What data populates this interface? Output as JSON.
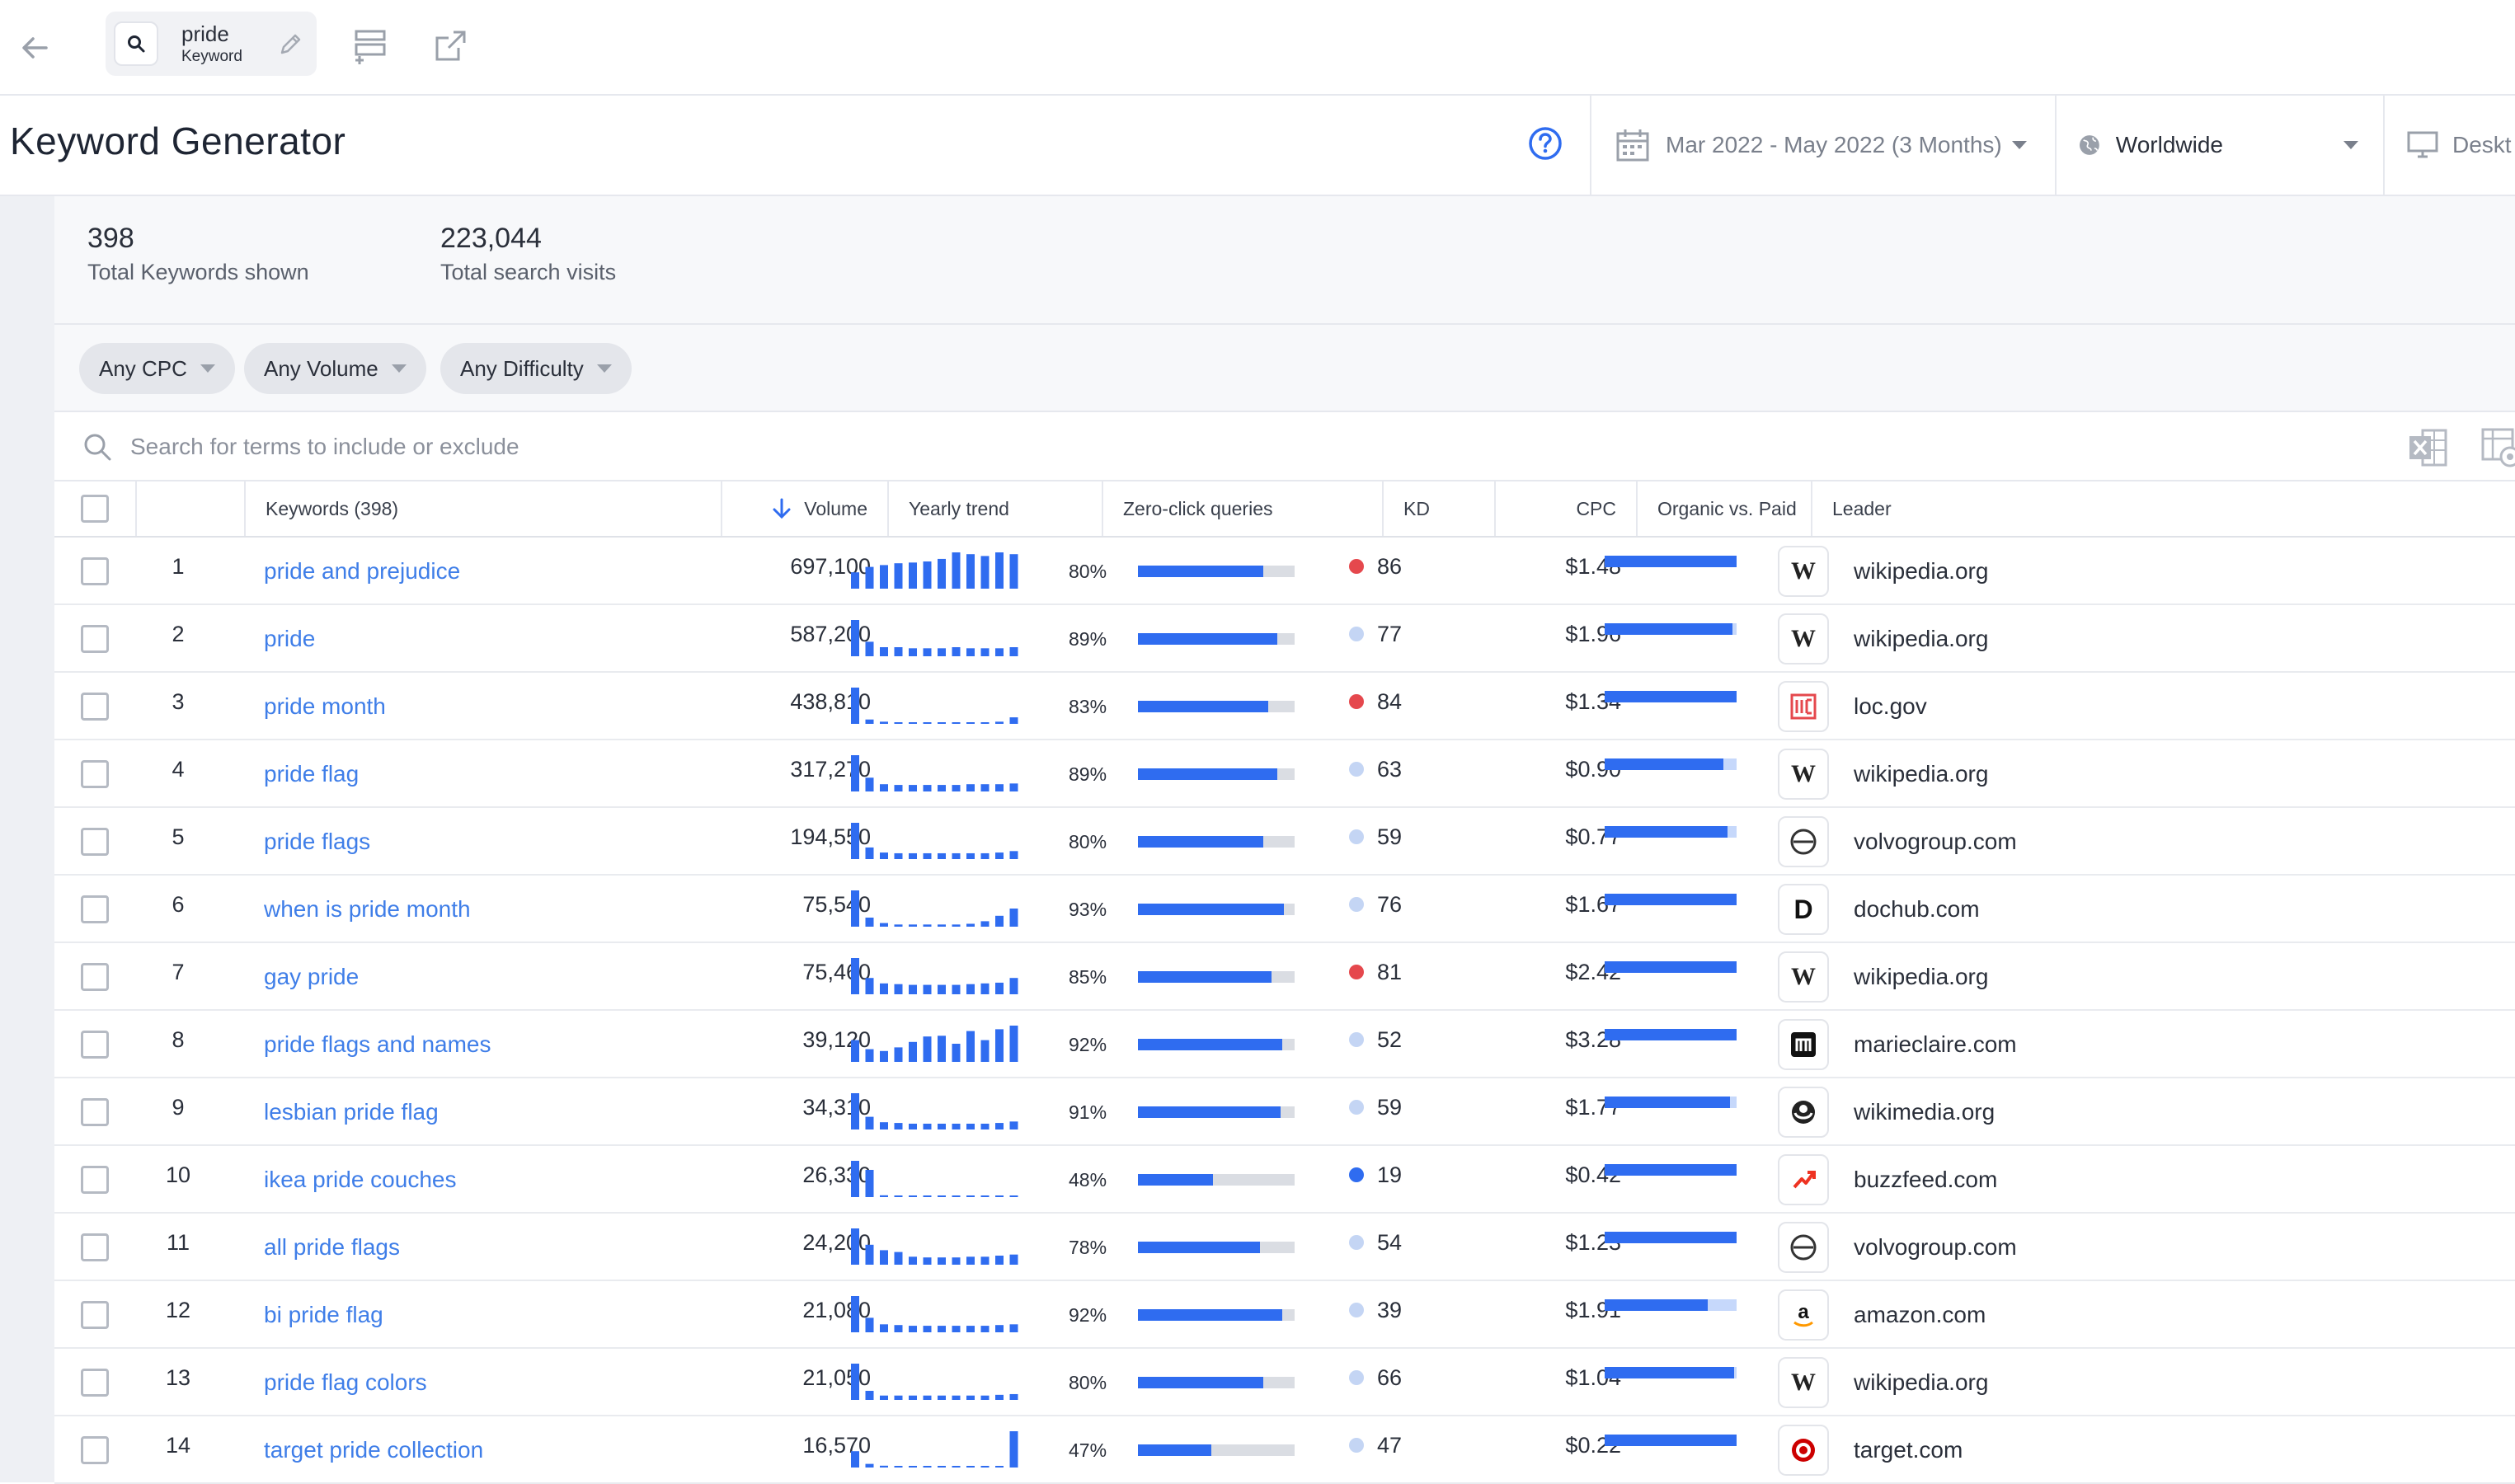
{
  "topbar": {
    "chip_title": "pride",
    "chip_subtitle": "Keyword"
  },
  "header": {
    "title": "Keyword Generator",
    "date_range": "Mar 2022 - May 2022 (3 Months)",
    "region": "Worldwide",
    "device": "Deskt"
  },
  "summary": {
    "keywords_count": "398",
    "keywords_label": "Total Keywords shown",
    "visits_count": "223,044",
    "visits_label": "Total search visits"
  },
  "filters": {
    "cpc": "Any CPC",
    "volume": "Any Volume",
    "difficulty": "Any Difficulty"
  },
  "search": {
    "placeholder": "Search for terms to include or exclude"
  },
  "columns": {
    "keywords": "Keywords (398)",
    "volume": "Volume",
    "trend": "Yearly trend",
    "zero_click": "Zero-click queries",
    "kd": "KD",
    "cpc": "CPC",
    "ovp": "Organic vs. Paid",
    "leader": "Leader"
  },
  "colors": {
    "accent": "#2f6cf0",
    "link": "#3f7ee8",
    "kd_high": "#e5484d",
    "kd_mid": "#c4d5f4",
    "kd_low": "#2f6cf0"
  },
  "rows": [
    {
      "n": "1",
      "kw": "pride and prejudice",
      "vol": "697,100",
      "trend": [
        0.45,
        0.6,
        0.65,
        0.7,
        0.72,
        0.75,
        0.82,
        1.0,
        0.95,
        0.9,
        1.0,
        0.95
      ],
      "zc": "80%",
      "zcv": 0.8,
      "kd": "86",
      "kdlvl": "high",
      "cpc": "$1.48",
      "ovp": 1.0,
      "logo": "wikipedia-logo",
      "leader": "wikipedia.org"
    },
    {
      "n": "2",
      "kw": "pride",
      "vol": "587,200",
      "trend": [
        1.0,
        0.4,
        0.25,
        0.25,
        0.22,
        0.22,
        0.22,
        0.25,
        0.22,
        0.22,
        0.22,
        0.25
      ],
      "zc": "89%",
      "zcv": 0.89,
      "kd": "77",
      "kdlvl": "mid",
      "cpc": "$1.96",
      "ovp": 0.97,
      "logo": "wikipedia-logo",
      "leader": "wikipedia.org"
    },
    {
      "n": "3",
      "kw": "pride month",
      "vol": "438,810",
      "trend": [
        1.0,
        0.12,
        0.06,
        0.04,
        0.04,
        0.04,
        0.04,
        0.04,
        0.04,
        0.04,
        0.06,
        0.18
      ],
      "zc": "83%",
      "zcv": 0.83,
      "kd": "84",
      "kdlvl": "high",
      "cpc": "$1.34",
      "ovp": 1.0,
      "logo": "loc-logo",
      "leader": "loc.gov"
    },
    {
      "n": "4",
      "kw": "pride flag",
      "vol": "317,270",
      "trend": [
        1.0,
        0.38,
        0.2,
        0.18,
        0.18,
        0.18,
        0.18,
        0.18,
        0.2,
        0.2,
        0.2,
        0.22
      ],
      "zc": "89%",
      "zcv": 0.89,
      "kd": "63",
      "kdlvl": "mid",
      "cpc": "$0.90",
      "ovp": 0.9,
      "logo": "wikipedia-logo",
      "leader": "wikipedia.org"
    },
    {
      "n": "5",
      "kw": "pride flags",
      "vol": "194,550",
      "trend": [
        1.0,
        0.32,
        0.18,
        0.16,
        0.16,
        0.16,
        0.16,
        0.16,
        0.16,
        0.16,
        0.18,
        0.22
      ],
      "zc": "80%",
      "zcv": 0.8,
      "kd": "59",
      "kdlvl": "mid",
      "cpc": "$0.77",
      "ovp": 0.93,
      "logo": "volvo-logo",
      "leader": "volvogroup.com"
    },
    {
      "n": "6",
      "kw": "when is pride month",
      "vol": "75,540",
      "trend": [
        1.0,
        0.25,
        0.1,
        0.06,
        0.06,
        0.06,
        0.06,
        0.06,
        0.08,
        0.15,
        0.3,
        0.5
      ],
      "zc": "93%",
      "zcv": 0.93,
      "kd": "76",
      "kdlvl": "mid",
      "cpc": "$1.67",
      "ovp": 1.0,
      "logo": "dochub-logo",
      "leader": "dochub.com"
    },
    {
      "n": "7",
      "kw": "gay pride",
      "vol": "75,460",
      "trend": [
        1.0,
        0.45,
        0.3,
        0.28,
        0.26,
        0.26,
        0.26,
        0.26,
        0.28,
        0.3,
        0.32,
        0.45
      ],
      "zc": "85%",
      "zcv": 0.85,
      "kd": "81",
      "kdlvl": "high",
      "cpc": "$2.42",
      "ovp": 1.0,
      "logo": "wikipedia-logo",
      "leader": "wikipedia.org"
    },
    {
      "n": "8",
      "kw": "pride flags and names",
      "vol": "39,120",
      "trend": [
        0.6,
        0.35,
        0.3,
        0.4,
        0.55,
        0.7,
        0.72,
        0.5,
        0.85,
        0.6,
        0.9,
        1.0
      ],
      "zc": "92%",
      "zcv": 0.92,
      "kd": "52",
      "kdlvl": "mid",
      "cpc": "$3.28",
      "ovp": 1.0,
      "logo": "marieclaire-logo",
      "leader": "marieclaire.com"
    },
    {
      "n": "9",
      "kw": "lesbian pride flag",
      "vol": "34,310",
      "trend": [
        1.0,
        0.35,
        0.2,
        0.18,
        0.16,
        0.16,
        0.16,
        0.16,
        0.16,
        0.16,
        0.18,
        0.22
      ],
      "zc": "91%",
      "zcv": 0.91,
      "kd": "59",
      "kdlvl": "mid",
      "cpc": "$1.77",
      "ovp": 0.95,
      "logo": "wikimedia-logo",
      "leader": "wikimedia.org"
    },
    {
      "n": "10",
      "kw": "ikea pride couches",
      "vol": "26,330",
      "trend": [
        1.0,
        0.75,
        0.05,
        0.03,
        0.02,
        0.02,
        0.02,
        0.02,
        0.02,
        0.02,
        0.02,
        0.02
      ],
      "zc": "48%",
      "zcv": 0.48,
      "kd": "19",
      "kdlvl": "low",
      "cpc": "$0.42",
      "ovp": 1.0,
      "logo": "buzzfeed-logo",
      "leader": "buzzfeed.com"
    },
    {
      "n": "11",
      "kw": "all pride flags",
      "vol": "24,200",
      "trend": [
        1.0,
        0.55,
        0.4,
        0.35,
        0.22,
        0.2,
        0.2,
        0.2,
        0.22,
        0.22,
        0.25,
        0.28
      ],
      "zc": "78%",
      "zcv": 0.78,
      "kd": "54",
      "kdlvl": "mid",
      "cpc": "$1.23",
      "ovp": 1.0,
      "logo": "volvo-logo",
      "leader": "volvogroup.com"
    },
    {
      "n": "12",
      "kw": "bi pride flag",
      "vol": "21,080",
      "trend": [
        1.0,
        0.4,
        0.22,
        0.2,
        0.18,
        0.18,
        0.18,
        0.18,
        0.18,
        0.18,
        0.2,
        0.22
      ],
      "zc": "92%",
      "zcv": 0.92,
      "kd": "39",
      "kdlvl": "mid",
      "cpc": "$1.91",
      "ovp": 0.78,
      "logo": "amazon-logo",
      "leader": "amazon.com"
    },
    {
      "n": "13",
      "kw": "pride flag colors",
      "vol": "21,050",
      "trend": [
        1.0,
        0.25,
        0.12,
        0.12,
        0.12,
        0.12,
        0.12,
        0.12,
        0.12,
        0.12,
        0.14,
        0.16
      ],
      "zc": "80%",
      "zcv": 0.8,
      "kd": "66",
      "kdlvl": "mid",
      "cpc": "$1.04",
      "ovp": 0.98,
      "logo": "wikipedia-logo",
      "leader": "wikipedia.org"
    },
    {
      "n": "14",
      "kw": "target pride collection",
      "vol": "16,570",
      "trend": [
        0.45,
        0.1,
        0.05,
        0.04,
        0.04,
        0.04,
        0.04,
        0.04,
        0.04,
        0.04,
        0.04,
        1.0
      ],
      "zc": "47%",
      "zcv": 0.47,
      "kd": "47",
      "kdlvl": "mid",
      "cpc": "$0.22",
      "ovp": 1.0,
      "logo": "target-logo",
      "leader": "target.com"
    }
  ]
}
